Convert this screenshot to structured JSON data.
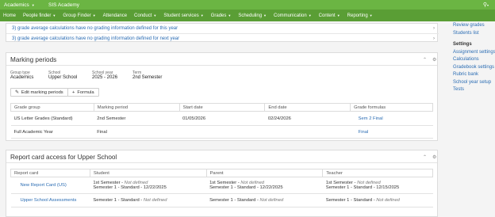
{
  "topbar": {
    "app_label": "Academics",
    "org": "SIS Academy",
    "search_icon": "search-icon"
  },
  "nav": [
    "Home",
    "People finder",
    "Group Finder",
    "Attendance",
    "Conduct",
    "Student services",
    "Grades",
    "Scheduling",
    "Communication",
    "Content",
    "Reporting"
  ],
  "nav_has_caret": [
    false,
    true,
    true,
    false,
    true,
    true,
    true,
    true,
    true,
    true,
    true
  ],
  "alerts": [
    "3) grade average calculations have no grading information defined for this year",
    "3) grade average calculations have no grading information defined for next year"
  ],
  "marking": {
    "title": "Marking periods",
    "group_type_label": "Group type",
    "group_type": "Academics",
    "school_label": "School",
    "school": "Upper School",
    "year_label": "School year",
    "year": "2025 - 2026",
    "term_label": "Term",
    "term": "2nd Semester",
    "edit_button": "Edit marking periods",
    "formula_button": "Formula",
    "columns": [
      "Grade group",
      "Marking period",
      "Start date",
      "End date",
      "Grade formulas"
    ],
    "rows": [
      [
        "US Letter Grades (Standard)",
        "2nd Semester",
        "01/05/2026",
        "02/24/2026",
        "Sem 2 Final"
      ],
      [
        "Full Academic Year",
        "Final",
        "",
        "",
        "Final"
      ]
    ]
  },
  "report": {
    "title": "Report card access for Upper School",
    "columns": [
      "Report card",
      "Student",
      "Parent",
      "Teacher"
    ],
    "rows": [
      {
        "name": "New Report Card (US)",
        "student": [
          "1st Semester - ",
          "Not defined",
          "Semester 1 - Standard - 12/22/2025"
        ],
        "parent": [
          "1st Semester - ",
          "Not defined",
          "Semester 1 - Standard - 12/22/2025"
        ],
        "teacher": [
          "1st Semester - ",
          "Not defined",
          "Semester 1 - Standard - 12/15/2025"
        ]
      },
      {
        "name": "Upper School Assessments",
        "student": [
          "Semester 1 - Standard - ",
          "Not defined"
        ],
        "parent": [
          "Semester 1 - Standard - ",
          "Not defined"
        ],
        "teacher": [
          "Semester 1 - Standard - ",
          "Not defined"
        ]
      }
    ]
  },
  "sidebar": {
    "top_links": [
      "Review grades",
      "Students list"
    ],
    "settings_header": "Settings",
    "settings_links": [
      "Assignment settings",
      "Calculations",
      "Gradebook settings",
      "Rubric bank",
      "School year setup",
      "Tests"
    ]
  }
}
